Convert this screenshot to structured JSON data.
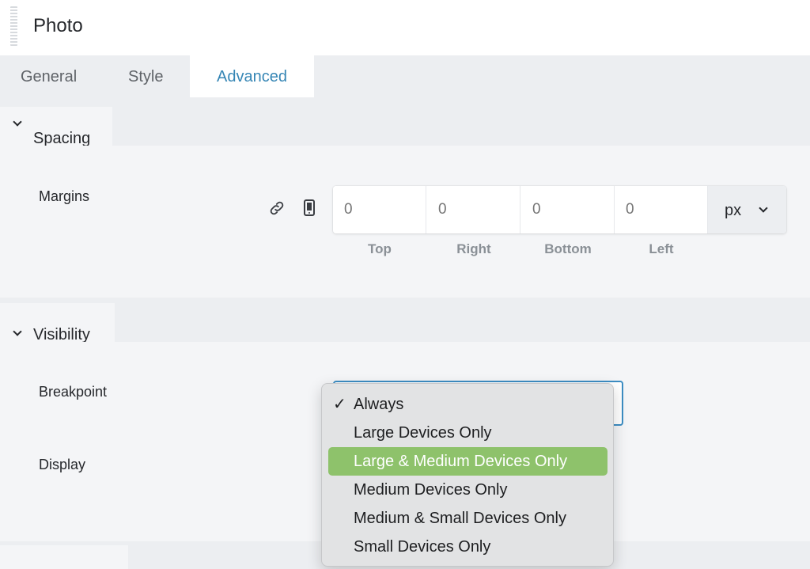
{
  "header": {
    "title": "Photo"
  },
  "tabs": [
    {
      "label": "General"
    },
    {
      "label": "Style"
    },
    {
      "label": "Advanced",
      "active": true
    }
  ],
  "spacing": {
    "title": "Spacing",
    "margins_label": "Margins",
    "link_icon": "link-icon",
    "device_icon": "mobile-device-icon",
    "values": {
      "top": "0",
      "right": "0",
      "bottom": "0",
      "left": "0"
    },
    "captions": {
      "top": "Top",
      "right": "Right",
      "bottom": "Bottom",
      "left": "Left"
    },
    "unit": "px"
  },
  "visibility": {
    "title": "Visibility",
    "breakpoint_label": "Breakpoint",
    "display_label": "Display",
    "checked_option": "Always",
    "highlighted_option": "Large & Medium Devices Only",
    "options": [
      {
        "label": "Always"
      },
      {
        "label": "Large Devices Only"
      },
      {
        "label": "Large & Medium Devices Only"
      },
      {
        "label": "Medium Devices Only"
      },
      {
        "label": "Medium & Small Devices Only"
      },
      {
        "label": "Small Devices Only"
      }
    ]
  },
  "colors": {
    "accent": "#3686b5",
    "focus_border": "#3c8dc3",
    "highlight": "#8ec26b",
    "panel_bg": "#f4f5f7",
    "tab_bar_bg": "#eceef1"
  }
}
